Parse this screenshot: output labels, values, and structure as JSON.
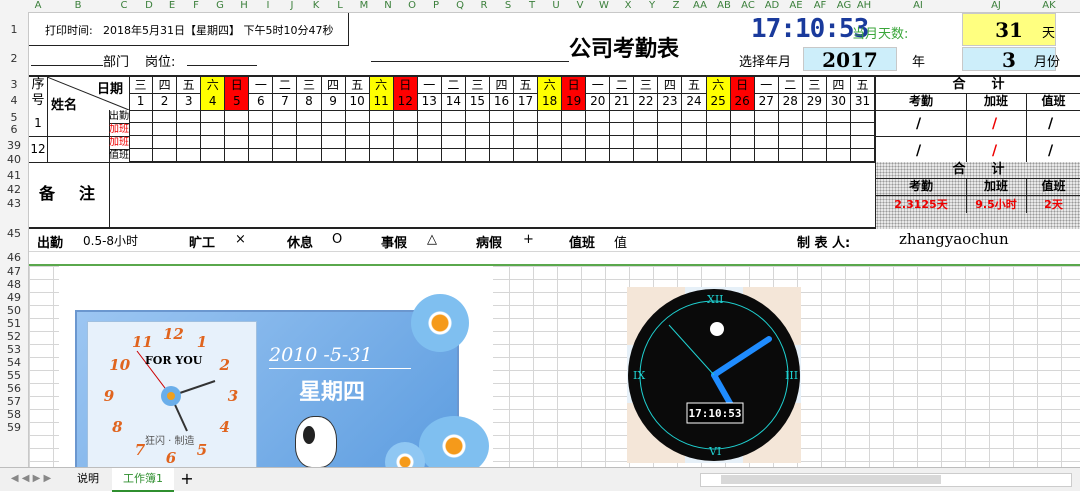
{
  "columns": [
    "A",
    "B",
    "C",
    "D",
    "E",
    "F",
    "G",
    "H",
    "I",
    "J",
    "K",
    "L",
    "M",
    "N",
    "O",
    "P",
    "Q",
    "R",
    "S",
    "T",
    "U",
    "V",
    "W",
    "X",
    "Y",
    "Z",
    "AA",
    "AB",
    "AC",
    "AD",
    "AE",
    "AF",
    "AG",
    "AH",
    "AI",
    "AJ",
    "AK"
  ],
  "rows": [
    "1",
    "2",
    "3",
    "4",
    "5",
    "6",
    "39",
    "40",
    "41",
    "42",
    "43",
    "45",
    "46",
    "47",
    "48",
    "49",
    "50",
    "51",
    "52",
    "53",
    "54",
    "55",
    "56",
    "57",
    "58",
    "59"
  ],
  "header": {
    "print_time_label": "打印时间:",
    "print_time_value": "2018年5月31日【星期四】 下午5时10分47秒",
    "clock_display": "17:10:53",
    "month_days_label": "当月天数:",
    "month_days_value": "31",
    "day_unit": "天",
    "dept_label": "部门",
    "post_label": "岗位:",
    "title": "公司考勤表",
    "select_label": "选择年月",
    "year_value": "2017",
    "year_unit": "年",
    "month_value": "3",
    "month_unit": "月份"
  },
  "table": {
    "seq_label_1": "序",
    "seq_label_2": "号",
    "name_label": "姓名",
    "date_label": "日期",
    "weekdays": [
      "三",
      "四",
      "五",
      "六",
      "日",
      "一",
      "二",
      "三",
      "四",
      "五",
      "六",
      "日",
      "一",
      "二",
      "三",
      "四",
      "五",
      "六",
      "日",
      "一",
      "二",
      "三",
      "四",
      "五",
      "六",
      "日",
      "一",
      "二",
      "三",
      "四",
      "五"
    ],
    "day_numbers": [
      "1",
      "2",
      "3",
      "4",
      "5",
      "6",
      "7",
      "8",
      "9",
      "10",
      "11",
      "12",
      "13",
      "14",
      "15",
      "16",
      "17",
      "18",
      "19",
      "20",
      "21",
      "22",
      "23",
      "24",
      "25",
      "26",
      "27",
      "28",
      "29",
      "30",
      "31"
    ],
    "weekday_colors": {
      "sat": "#ffff00",
      "sun": "#ff0000"
    },
    "summary_title": "合　　计",
    "summary_cols": [
      "考勤",
      "加班",
      "值班"
    ],
    "row1_no": "1",
    "row1_types": [
      "出勤",
      "加班"
    ],
    "row12_no": "12",
    "row12_types": [
      "加班",
      "值班"
    ],
    "slash": "/"
  },
  "notes": {
    "label": "备　注",
    "summary_title": "合　　计",
    "summary_cols": [
      "考勤",
      "加班",
      "值班"
    ],
    "summary_vals": [
      "2.3125天",
      "9.5小时",
      "2天"
    ]
  },
  "legend": {
    "items": [
      {
        "label": "出勤",
        "value": "0.5-8小时"
      },
      {
        "label": "旷工",
        "value": "×"
      },
      {
        "label": "休息",
        "value": "O"
      },
      {
        "label": "事假",
        "value": "△"
      },
      {
        "label": "病假",
        "value": "+"
      },
      {
        "label": "值班",
        "value": "值"
      }
    ],
    "maker_label": "制 表 人:",
    "maker_value": "zhangyaochun"
  },
  "calendar_widget": {
    "date_text": "2010 -5-31",
    "weekday_text": "星期四",
    "for_you": "FOR YOU",
    "author": "狂闪 · 制造",
    "numbers": [
      "12",
      "1",
      "2",
      "3",
      "4",
      "5",
      "6",
      "7",
      "8",
      "9",
      "10",
      "11"
    ]
  },
  "round_clock": {
    "numerals": [
      "XII",
      "III",
      "VI",
      "IX"
    ],
    "digital": "17:10:53"
  },
  "sheet_tabs": [
    "说明",
    "工作簿1"
  ],
  "add_tab": "+",
  "colors": {
    "accent_green": "#5aa84c",
    "lcd_blue": "#1a3a9c",
    "highlight_yellow": "#ffff80",
    "highlight_blue": "#cdeefa",
    "red": "#ff0000"
  }
}
